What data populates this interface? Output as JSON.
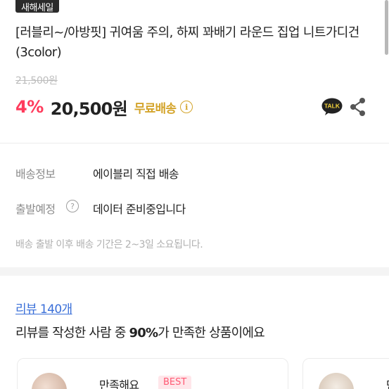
{
  "product": {
    "badge": "새해세일",
    "title": "[러블리~/아방핏] 귀여움 주의, 하찌 꽈배기 라운드 집업 니트가디건 (3color)",
    "original_price": "21,500원",
    "discount": "4%",
    "price": "20,500원",
    "free_shipping": "무료배송",
    "info_icon": "i",
    "talk_label": "TALK"
  },
  "shipping": {
    "delivery_label": "배송정보",
    "delivery_value": "에이블리 직접 배송",
    "departure_label": "출발예정",
    "departure_help": "?",
    "departure_value": "데이터 준비중입니다",
    "note": "배송 출발 이후 배송 기간은 2~3일 소요됩니다."
  },
  "reviews": {
    "link": "리뷰 140개",
    "summary_prefix": "리뷰를 작성한 사람 중 ",
    "summary_percent": "90%",
    "summary_suffix": "가 만족한 상품이에요",
    "card1_title": "만족해요",
    "card1_badge": "BEST",
    "card2_title": "만"
  },
  "colors": {
    "discount": "#ff3b5c",
    "free_shipping": "#d4a42b",
    "link": "#3a6fd8",
    "best_badge_bg": "#ffe6ea"
  },
  "icons": [
    "kakaotalk-icon",
    "share-icon",
    "info-icon",
    "help-icon"
  ]
}
